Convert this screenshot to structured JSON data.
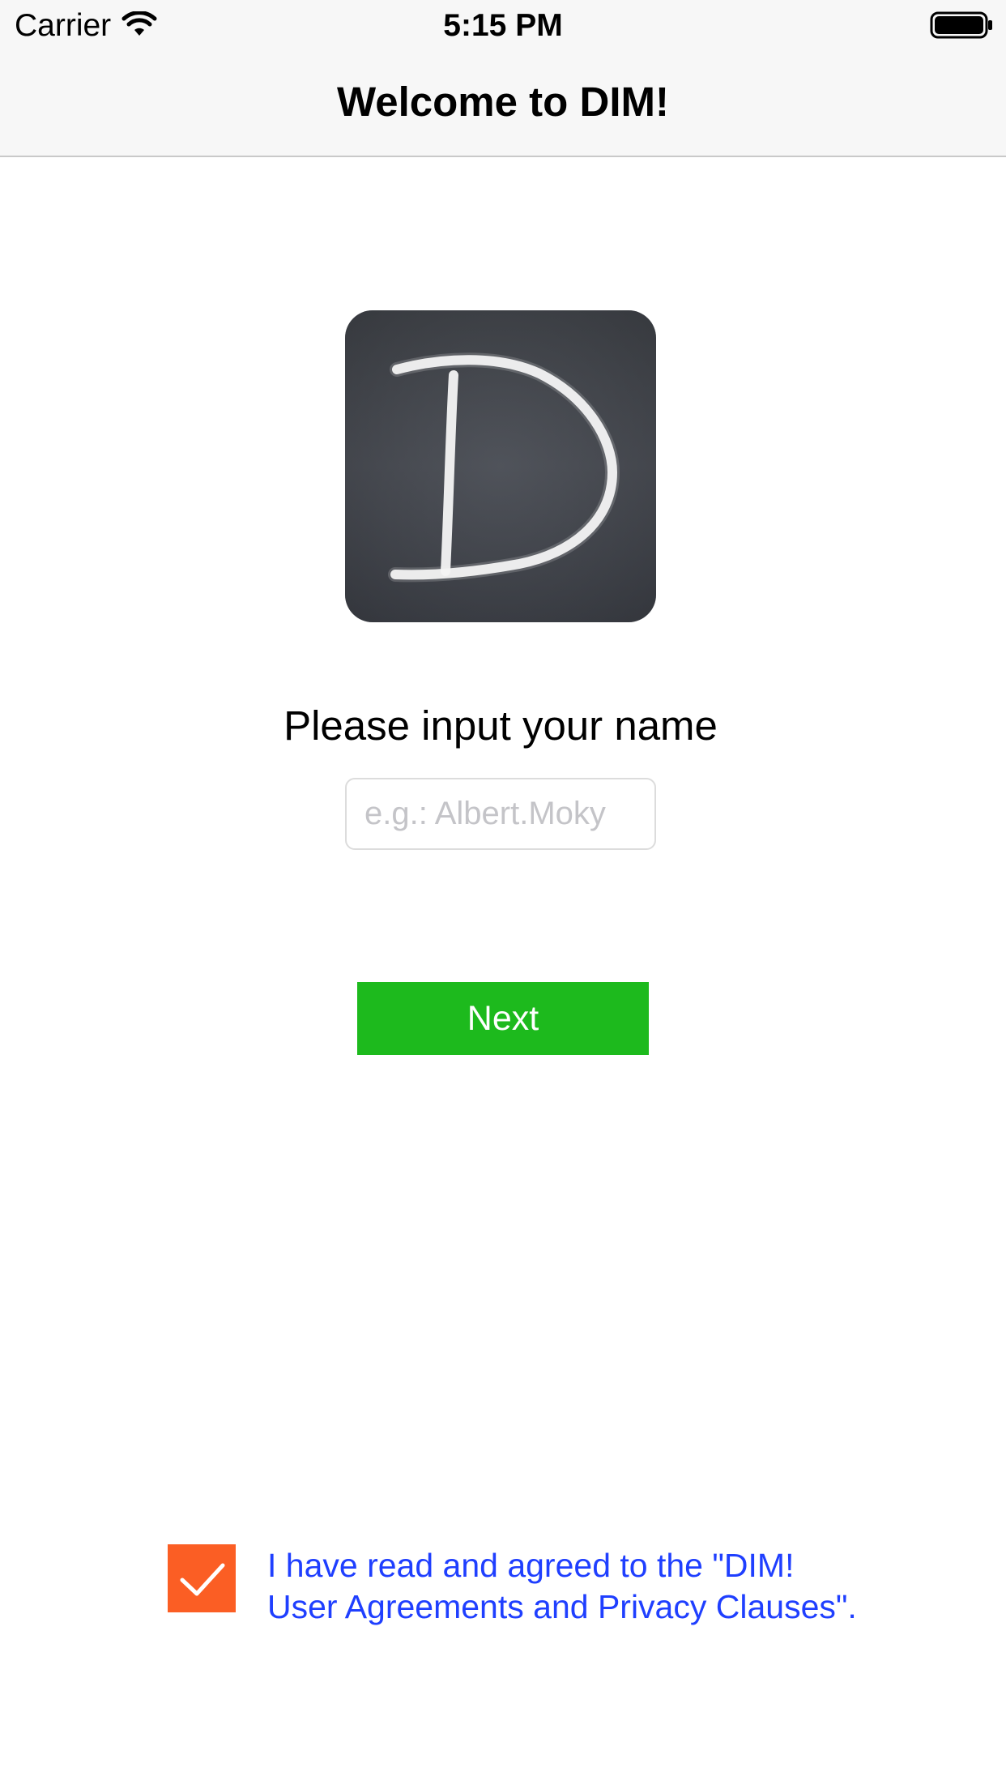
{
  "status_bar": {
    "carrier": "Carrier",
    "time": "5:15 PM",
    "wifi_icon": "wifi-icon",
    "battery_icon": "battery-icon"
  },
  "nav": {
    "title": "Welcome to DIM!"
  },
  "logo": {
    "icon": "dim-chalkboard-logo",
    "letter": "D"
  },
  "form": {
    "prompt": "Please input your name",
    "name_placeholder": "e.g.: Albert.Moky",
    "name_value": "",
    "next_label": "Next"
  },
  "agreement": {
    "checked": true,
    "check_icon": "checkmark-icon",
    "line1": "I have read and agreed to the \"DIM!",
    "line2": "User Agreements and Privacy Clauses\"."
  },
  "colors": {
    "accent_green": "#1dba1d",
    "checkbox_orange": "#fb5e24",
    "link_blue": "#1f3fff",
    "nav_background": "#f7f7f7"
  }
}
